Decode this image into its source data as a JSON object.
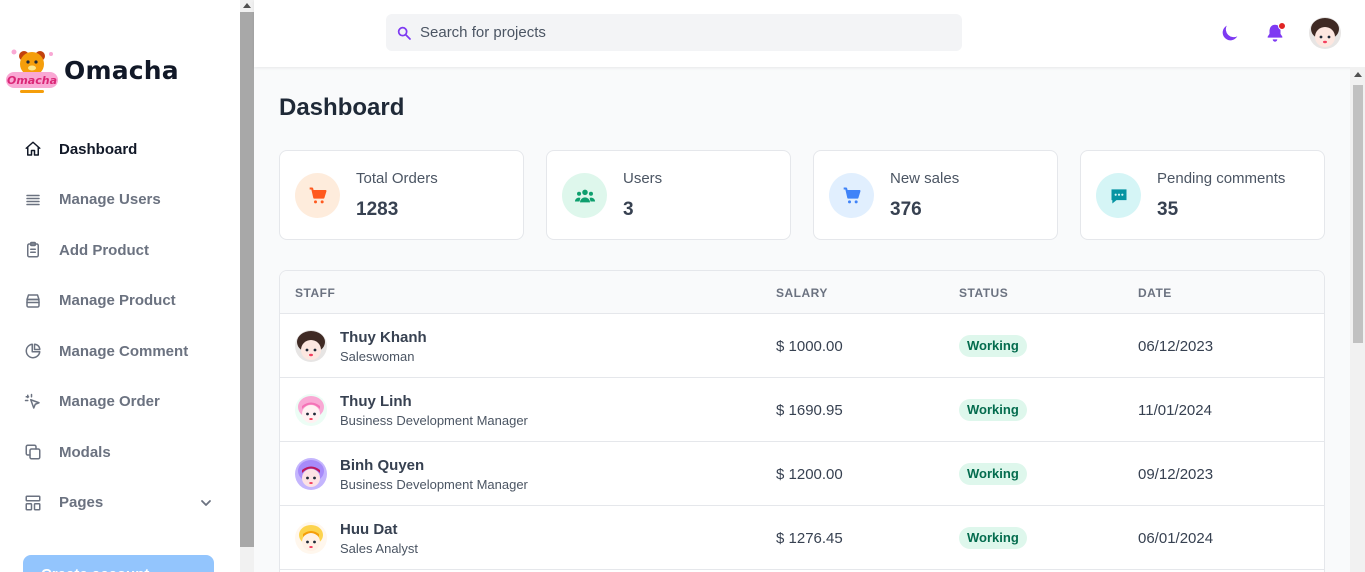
{
  "app": {
    "brand_name": "Omacha"
  },
  "sidebar": {
    "items": [
      {
        "label": "Dashboard",
        "icon": "home-icon"
      },
      {
        "label": "Manage Users",
        "icon": "list-icon"
      },
      {
        "label": "Add Product",
        "icon": "clipboard-icon"
      },
      {
        "label": "Manage Product",
        "icon": "box-icon"
      },
      {
        "label": "Manage Comment",
        "icon": "pie-chart-icon"
      },
      {
        "label": "Manage Order",
        "icon": "cursor-click-icon"
      },
      {
        "label": "Modals",
        "icon": "copy-icon"
      },
      {
        "label": "Pages",
        "icon": "layout-icon"
      }
    ],
    "create_account_label": "Create account"
  },
  "header": {
    "search_placeholder": "Search for projects",
    "notification_dot_color": "#e02424",
    "accent_color": "#7e3af2"
  },
  "main": {
    "title": "Dashboard",
    "cards": [
      {
        "label": "Total Orders",
        "value": "1283",
        "icon": "cart-icon",
        "color": "#ff5a1f",
        "bg": "#feecdc"
      },
      {
        "label": "Users",
        "value": "3",
        "icon": "users-icon",
        "color": "#0e9f6e",
        "bg": "#def7ec"
      },
      {
        "label": "New sales",
        "value": "376",
        "icon": "cart-icon",
        "color": "#3f83f8",
        "bg": "#e1effe"
      },
      {
        "label": "Pending comments",
        "value": "35",
        "icon": "chat-icon",
        "color": "#0694a2",
        "bg": "#d5f5f6"
      }
    ],
    "table": {
      "headers": [
        "STAFF",
        "SALARY",
        "STATUS",
        "DATE"
      ],
      "rows": [
        {
          "name": "Thuy Khanh",
          "role": "Saleswoman",
          "salary": "$ 1000.00",
          "status": "Working",
          "date": "06/12/2023"
        },
        {
          "name": "Thuy Linh",
          "role": "Business Development Manager",
          "salary": "$ 1690.95",
          "status": "Working",
          "date": "11/01/2024"
        },
        {
          "name": "Binh Quyen",
          "role": "Business Development Manager",
          "salary": "$ 1200.00",
          "status": "Working",
          "date": "09/12/2023"
        },
        {
          "name": "Huu Dat",
          "role": "Sales Analyst",
          "salary": "$ 1276.45",
          "status": "Working",
          "date": "06/01/2024"
        }
      ]
    }
  }
}
